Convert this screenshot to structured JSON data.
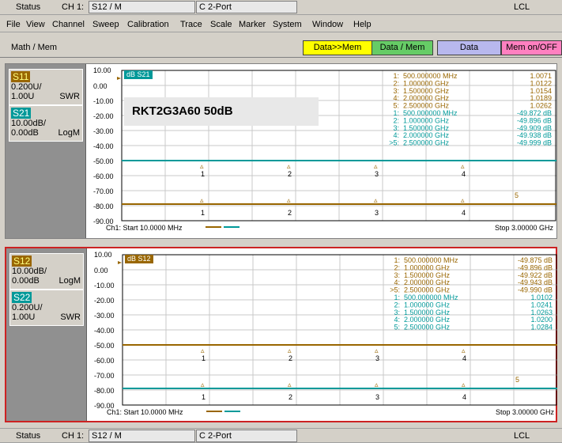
{
  "status_top": {
    "status": "Status",
    "channel": "CH 1:",
    "param": "S12 / M",
    "cal": "C  2-Port",
    "ref": "LCL"
  },
  "menu": [
    "File",
    "View",
    "Channel",
    "Sweep",
    "Calibration",
    "Trace",
    "Scale",
    "Marker",
    "System",
    "Window",
    "Help"
  ],
  "softkeys": {
    "title": "Math / Mem",
    "data_mem": "Data>>Mem",
    "data_div_mem": "Data / Mem",
    "data": "Data",
    "mem_onoff": "Mem on/OFF"
  },
  "colors": {
    "yellow": "#ffff00",
    "green": "#66cc66",
    "lavender": "#b8b8ee",
    "pink": "#ff80c0",
    "gold": "#996600",
    "teal": "#009999",
    "red": "#cc2222"
  },
  "overlay_label": "RKT2G3A60 50dB",
  "panel1": {
    "traces": [
      {
        "name": "S11",
        "scale": "0.200U/",
        "ref": "1.00U",
        "format": "SWR",
        "color": "#996600"
      },
      {
        "name": "S21",
        "scale": "10.00dB/",
        "ref": "0.00dB",
        "format": "LogM",
        "color": "#009999"
      }
    ],
    "active_label": "dB S21",
    "yticks": [
      "10.00",
      "0.00",
      "-10.00",
      "-20.00",
      "-30.00",
      "-40.00",
      "-50.00",
      "-60.00",
      "-70.00",
      "-80.00",
      "-90.00"
    ],
    "markers": [
      {
        "n": "1:",
        "f": "500.000000 MHz",
        "v": "1.0071",
        "c": "gold"
      },
      {
        "n": "2:",
        "f": "1.000000 GHz",
        "v": "1.0122",
        "c": "gold"
      },
      {
        "n": "3:",
        "f": "1.500000 GHz",
        "v": "1.0154",
        "c": "gold"
      },
      {
        "n": "4:",
        "f": "2.000000 GHz",
        "v": "1.0189",
        "c": "gold"
      },
      {
        "n": "5:",
        "f": "2.500000 GHz",
        "v": "1.0262",
        "c": "gold"
      },
      {
        "n": "1:",
        "f": "500.000000 MHz",
        "v": "-49.872 dB",
        "c": "teal"
      },
      {
        "n": "2:",
        "f": "1.000000 GHz",
        "v": "-49.896 dB",
        "c": "teal"
      },
      {
        "n": "3:",
        "f": "1.500000 GHz",
        "v": "-49.909 dB",
        "c": "teal"
      },
      {
        "n": "4:",
        "f": "2.000000 GHz",
        "v": "-49.938 dB",
        "c": "teal"
      },
      {
        "n": ">5:",
        "f": "2.500000 GHz",
        "v": "-49.999 dB",
        "c": "teal"
      }
    ],
    "start": "Ch1: Start  10.0000 MHz",
    "stop": "Stop  3.00000 GHz"
  },
  "panel2": {
    "traces": [
      {
        "name": "S12",
        "scale": "10.00dB/",
        "ref": "0.00dB",
        "format": "LogM",
        "color": "#996600"
      },
      {
        "name": "S22",
        "scale": "0.200U/",
        "ref": "1.00U",
        "format": "SWR",
        "color": "#009999"
      }
    ],
    "active_label": "dB S12",
    "yticks": [
      "10.00",
      "0.00",
      "-10.00",
      "-20.00",
      "-30.00",
      "-40.00",
      "-50.00",
      "-60.00",
      "-70.00",
      "-80.00",
      "-90.00"
    ],
    "markers": [
      {
        "n": "1:",
        "f": "500.000000 MHz",
        "v": "-49.875 dB",
        "c": "gold"
      },
      {
        "n": "2:",
        "f": "1.000000 GHz",
        "v": "-49.896 dB",
        "c": "gold"
      },
      {
        "n": "3:",
        "f": "1.500000 GHz",
        "v": "-49.922 dB",
        "c": "gold"
      },
      {
        "n": "4:",
        "f": "2.000000 GHz",
        "v": "-49.943 dB",
        "c": "gold"
      },
      {
        "n": ">5:",
        "f": "2.500000 GHz",
        "v": "-49.990 dB",
        "c": "gold"
      },
      {
        "n": "1:",
        "f": "500.000000 MHz",
        "v": "1.0102",
        "c": "teal"
      },
      {
        "n": "2:",
        "f": "1.000000 GHz",
        "v": "1.0241",
        "c": "teal"
      },
      {
        "n": "3:",
        "f": "1.500000 GHz",
        "v": "1.0263",
        "c": "teal"
      },
      {
        "n": "4:",
        "f": "2.000000 GHz",
        "v": "1.0200",
        "c": "teal"
      },
      {
        "n": "5:",
        "f": "2.500000 GHz",
        "v": "1.0284",
        "c": "teal"
      }
    ],
    "start": "Ch1: Start  10.0000 MHz",
    "stop": "Stop  3.00000 GHz"
  },
  "status_bottom": {
    "status": "Status",
    "channel": "CH 1:",
    "param": "S12 / M",
    "cal": "C  2-Port",
    "ref": "LCL"
  }
}
